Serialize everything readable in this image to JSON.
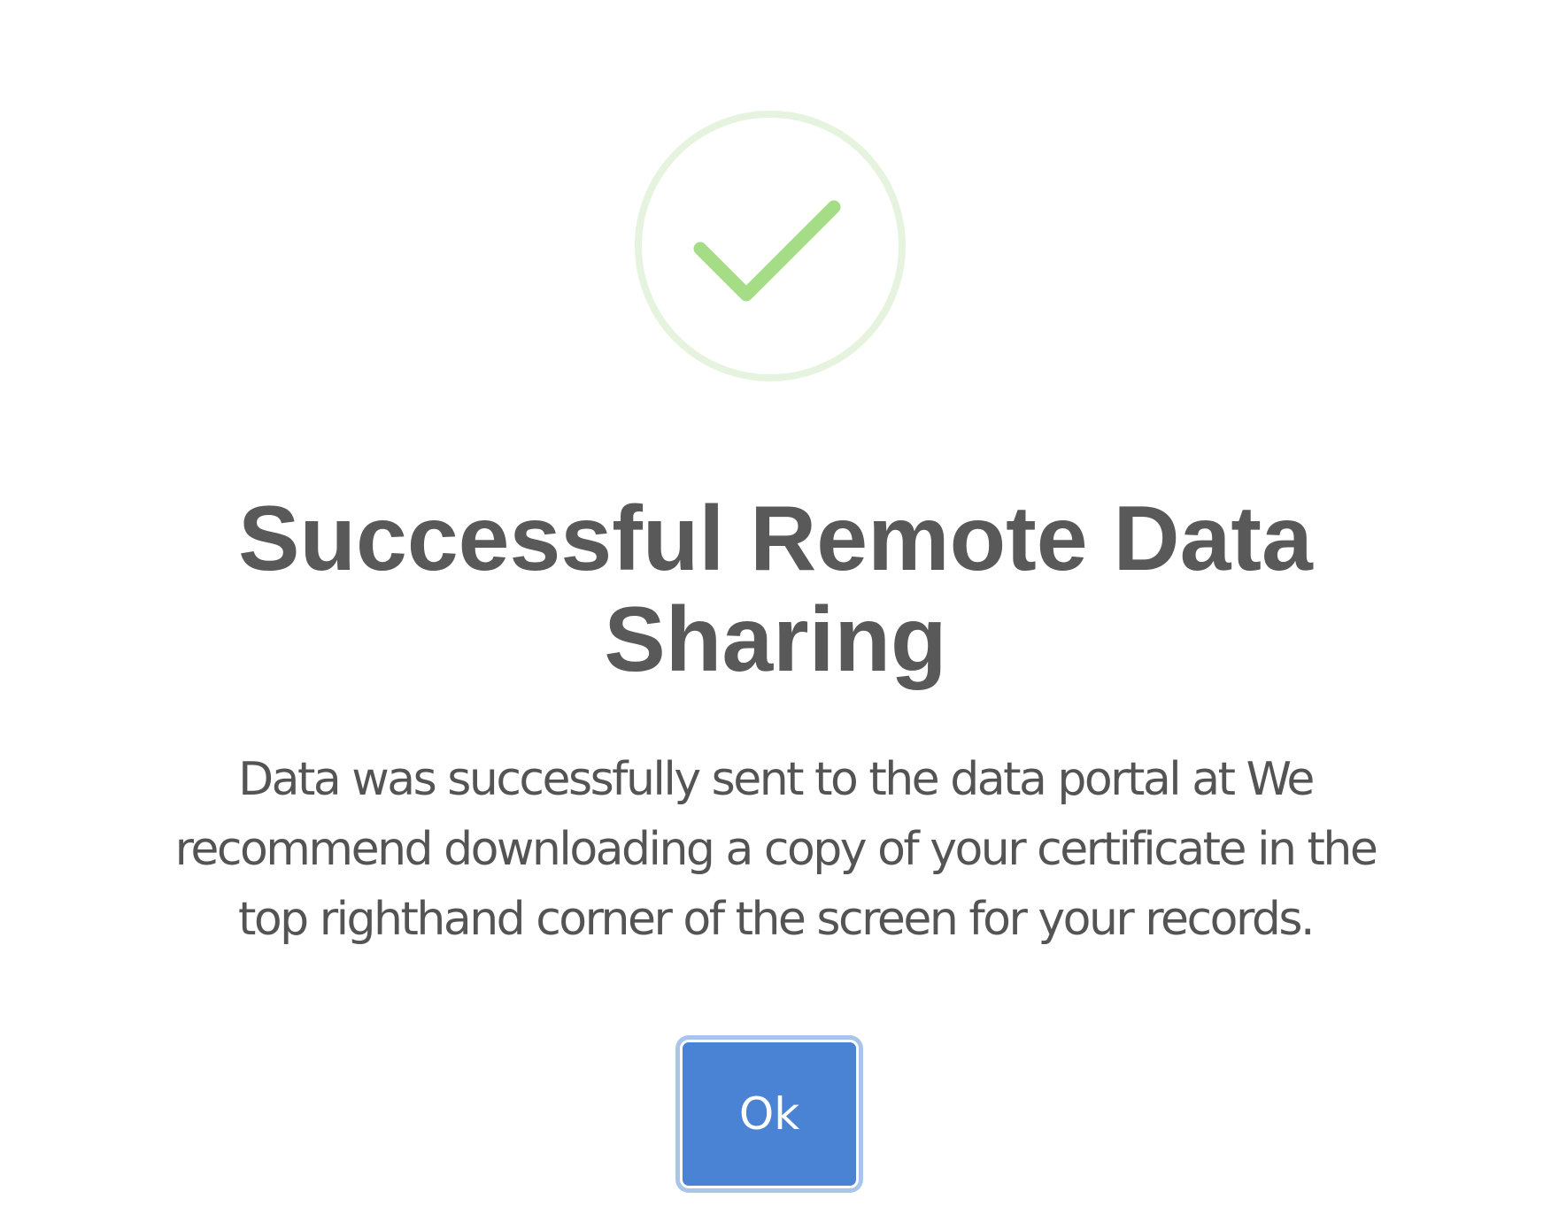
{
  "dialog": {
    "icon": "success-checkmark-icon",
    "title_line1": "Successful Remote Data",
    "title_line2": "Sharing",
    "message_lines": [
      "Data was successfully sent to the data portal at We",
      "recommend downloading a copy of your certificate in the",
      "top righthand corner of the screen for your records."
    ],
    "ok_label": "Ok"
  },
  "colors": {
    "check": "#a5dc86",
    "check_ring": "#e6f3de",
    "title": "#595959",
    "message": "#545454",
    "button": "#4a83d3",
    "button_focus": "#a9c6ea"
  }
}
